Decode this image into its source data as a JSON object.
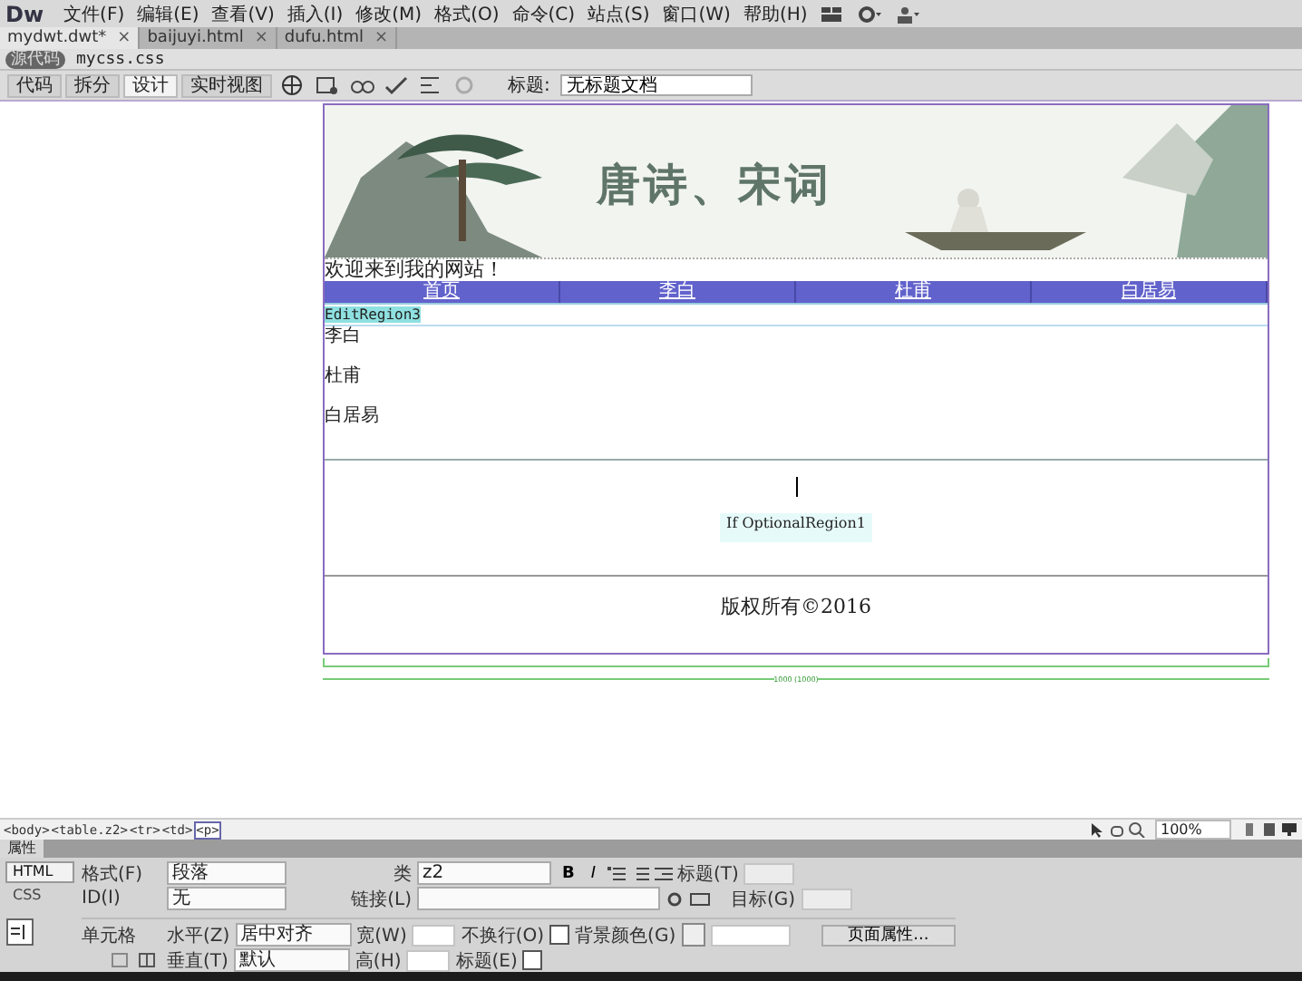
{
  "app_logo": "Dw",
  "menu_bar": [
    "文件(F)",
    "编辑(E)",
    "查看(V)",
    "插入(I)",
    "修改(M)",
    "格式(O)",
    "命令(C)",
    "站点(S)",
    "窗口(W)",
    "帮助(H)"
  ],
  "tabs": [
    {
      "label": "mydwt.dwt*",
      "selected": true
    },
    {
      "label": "baijuyi.html",
      "selected": false
    },
    {
      "label": "dufu.html",
      "selected": false
    }
  ],
  "tab_close": "×",
  "related_files": {
    "source": "源代码",
    "file": "mycss.css"
  },
  "doc_toolbar": {
    "views": [
      {
        "label": "代码",
        "selected": false
      },
      {
        "label": "拆分",
        "selected": false
      },
      {
        "label": "设计",
        "selected": true
      },
      {
        "label": "实时视图",
        "selected": false
      }
    ],
    "title_label": "标题:",
    "title_value": "无标题文档"
  },
  "page": {
    "banner_title": "唐诗、宋词",
    "welcome": "欢迎来到我的网站！",
    "nav": [
      "首页",
      "李白",
      "杜甫",
      "白居易"
    ],
    "edit_region": "EditRegion3",
    "list": [
      "李白",
      "杜甫",
      "白居易"
    ],
    "optional_region": "If OptionalRegion1",
    "footer": "版权所有©2016",
    "width_label": "1000 (1000)"
  },
  "status_bar": {
    "tags": [
      {
        "label": "<body>",
        "selected": false
      },
      {
        "label": "<table.z2>",
        "selected": false
      },
      {
        "label": "<tr>",
        "selected": false
      },
      {
        "label": "<td>",
        "selected": false
      },
      {
        "label": "<p>",
        "selected": true
      }
    ],
    "zoom": "100%"
  },
  "properties": {
    "title": "属性",
    "modes": [
      {
        "label": "HTML",
        "selected": true
      },
      {
        "label": "CSS",
        "selected": false
      }
    ],
    "format_label": "格式(F)",
    "format_value": "段落",
    "class_label": "类",
    "class_value": "z2",
    "bold": "B",
    "italic": "I",
    "heading_label": "标题(T)",
    "id_label": "ID(I)",
    "id_value": "无",
    "link_label": "链接(L)",
    "target_label": "目标(G)",
    "cell_label": "单元格",
    "horz_label": "水平(Z)",
    "horz_value": "居中对齐",
    "width_label": "宽(W)",
    "nowrap_label": "不换行(O)",
    "nowrap_checked": false,
    "bg_label": "背景颜色(G)",
    "page_props": "页面属性...",
    "vert_label": "垂直(T)",
    "vert_value": "默认",
    "height_label": "高(H)",
    "header_label": "标题(E)",
    "header_checked": false
  }
}
